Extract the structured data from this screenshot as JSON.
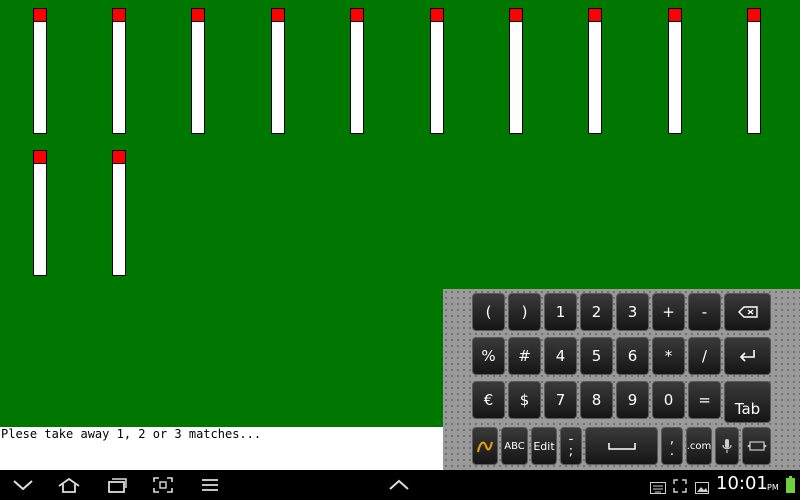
{
  "console": {
    "message": "Plese take away 1, 2 or 3 matches..."
  },
  "matches": {
    "count": 12
  },
  "keyboard": {
    "rows": [
      [
        "(",
        ")",
        "1",
        "2",
        "3",
        "+",
        "-"
      ],
      [
        "%",
        "#",
        "4",
        "5",
        "6",
        "*",
        "/"
      ],
      [
        "€",
        "$",
        "7",
        "8",
        "9",
        "0",
        "="
      ]
    ],
    "tab_label": "Tab",
    "abc_label": "ABC",
    "edit_label": "Edit",
    "dash_top": "-",
    "semicolon": ";",
    "comma_top": ",",
    "period": ".",
    "dotcom_label": ".com"
  },
  "status": {
    "time": "10:01",
    "ampm": "PM"
  },
  "colors": {
    "table": "#007800",
    "match_head": "#ff0000",
    "match_stick": "#ffffff"
  },
  "icons": {
    "nav": [
      "back-icon",
      "home-icon",
      "recent-apps-icon",
      "screenshot-icon",
      "menu-icon",
      "keyboard-hide-icon"
    ],
    "status": [
      "keyboard-icon",
      "fullscreen-icon",
      "picture-icon",
      "battery-icon"
    ]
  }
}
